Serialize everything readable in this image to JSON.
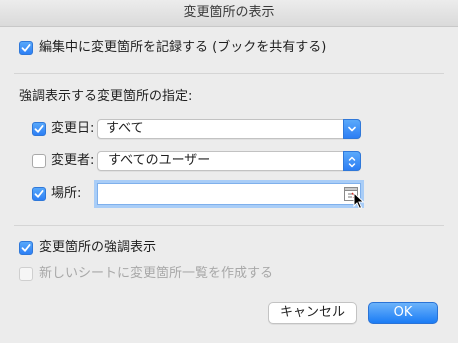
{
  "window": {
    "title": "変更箇所の表示"
  },
  "track_changes": {
    "label": "編集中に変更箇所を記録する (ブックを共有する)",
    "checked": true
  },
  "section": {
    "heading": "強調表示する変更箇所の指定:"
  },
  "when": {
    "label": "変更日:",
    "checked": true,
    "value": "すべて"
  },
  "who": {
    "label": "変更者:",
    "checked": false,
    "value": "すべてのユーザー"
  },
  "where": {
    "label": "場所:",
    "checked": true,
    "value": ""
  },
  "highlight_on_screen": {
    "label": "変更箇所の強調表示",
    "checked": true
  },
  "list_on_new_sheet": {
    "label": "新しいシートに変更箇所一覧を作成する",
    "checked": false,
    "enabled": false
  },
  "buttons": {
    "cancel": "キャンセル",
    "ok": "OK"
  },
  "colors": {
    "accent": "#2d7ff5",
    "background": "#ececec"
  }
}
